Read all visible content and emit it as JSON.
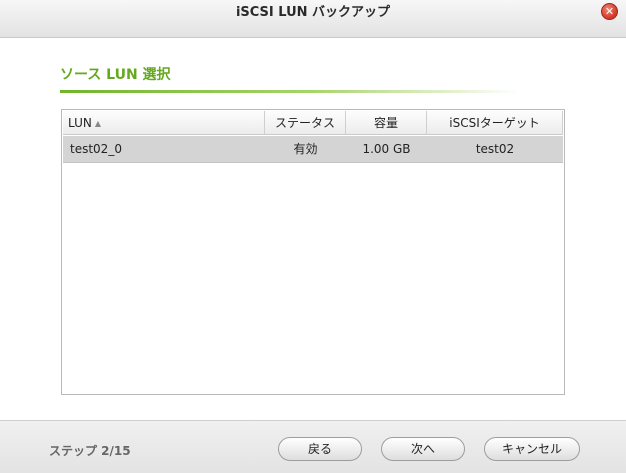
{
  "window": {
    "title": "iSCSI LUN バックアップ",
    "close_glyph": "✕"
  },
  "section": {
    "title": "ソース LUN 選択"
  },
  "table": {
    "columns": [
      "LUN",
      "ステータス",
      "容量",
      "iSCSIターゲット"
    ],
    "sort_indicator": "▲",
    "rows": [
      [
        "test02_0",
        "有効",
        "1.00 GB",
        "test02"
      ]
    ]
  },
  "footer": {
    "step": "ステップ 2/15",
    "back_label": "戻る",
    "next_label": "次へ",
    "cancel_label": "キャンセル"
  },
  "colors": {
    "accent_green": "#64a81e",
    "close_red": "#d6402d",
    "selected_row": "#d4d4d4"
  }
}
